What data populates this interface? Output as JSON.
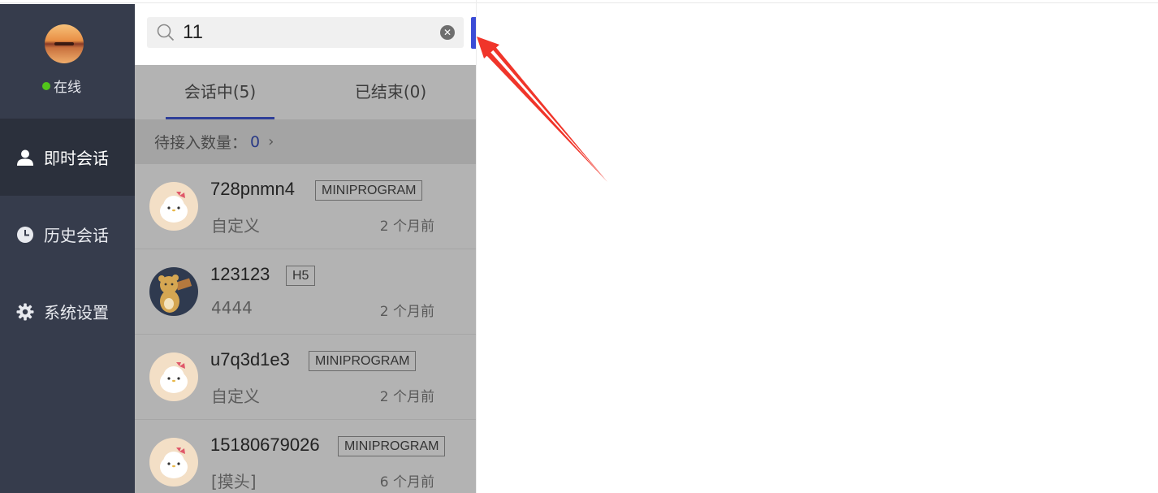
{
  "user": {
    "status": "在线",
    "status_color": "#52c41a"
  },
  "nav": [
    {
      "label": "即时会话",
      "icon": "user-icon",
      "active": true
    },
    {
      "label": "历史会话",
      "icon": "clock-icon",
      "active": false
    },
    {
      "label": "系统设置",
      "icon": "gear-icon",
      "active": false
    }
  ],
  "search": {
    "value": "11"
  },
  "tabs": [
    {
      "label": "会话中(5)",
      "active": true
    },
    {
      "label": "已结束(0)",
      "active": false
    }
  ],
  "pending": {
    "label": "待接入数量：",
    "count": "0"
  },
  "conversations": [
    {
      "name": "728pnmn4",
      "tag": "MINIPROGRAM",
      "message": "自定义",
      "time": "2 个月前",
      "avatar": "white-kitty-avatar"
    },
    {
      "name": "123123",
      "tag": "H5",
      "message": "4444",
      "time": "2 个月前",
      "avatar": "bear-avatar"
    },
    {
      "name": "u7q3d1e3",
      "tag": "MINIPROGRAM",
      "message": "自定义",
      "time": "2 个月前",
      "avatar": "white-kitty-avatar"
    },
    {
      "name": "15180679026",
      "tag": "MINIPROGRAM",
      "message": "[摸头]",
      "time": "6 个月前",
      "avatar": "white-kitty-avatar"
    }
  ],
  "colors": {
    "sidebar": "#363c4c",
    "accent": "#3b4cd6",
    "arrow": "#f0352a"
  }
}
